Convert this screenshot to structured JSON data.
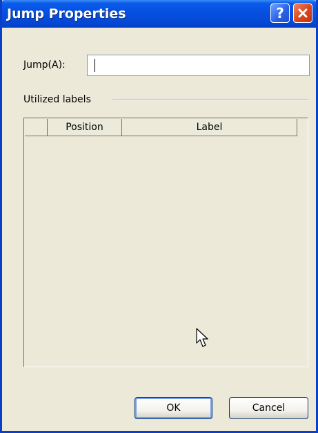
{
  "window": {
    "title": "Jump Properties"
  },
  "titlebar": {
    "help_icon": "question-mark-icon",
    "close_icon": "close-x-icon",
    "help_glyph": "?"
  },
  "jump": {
    "label": "Jump(A):",
    "value": ""
  },
  "group": {
    "label": "Utilized labels"
  },
  "table": {
    "columns": [
      "",
      "Position",
      "Label"
    ],
    "rows": []
  },
  "buttons": {
    "ok": "OK",
    "cancel": "Cancel"
  },
  "colors": {
    "titlebar": "#0554e0",
    "dialog_bg": "#ece9d8",
    "close_button": "#d9441c",
    "help_button": "#2a64e8"
  }
}
